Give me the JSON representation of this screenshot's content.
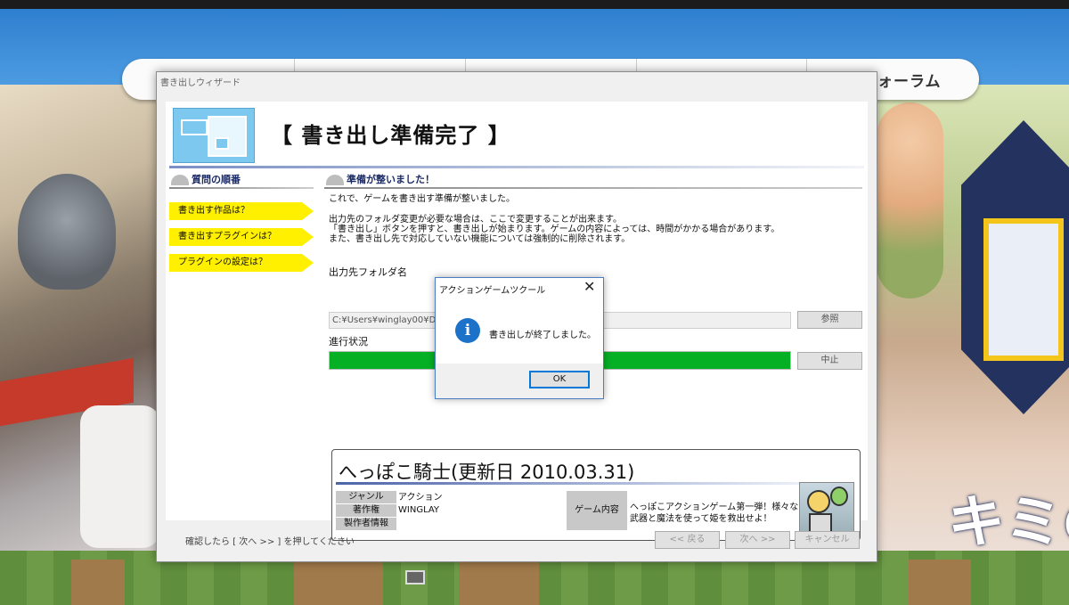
{
  "site": {
    "nav_partial_label": "ォーラム",
    "background_kana": "キミの"
  },
  "wizard": {
    "window_title": "書き出しウィザード",
    "header_title": "【 書き出し準備完了 】",
    "steps_heading": "質問の順番",
    "steps": [
      "書き出す作品は？",
      "書き出すプラグインは？",
      "プラグインの設定は？"
    ],
    "status_heading": "準備が整いました！",
    "message_1": "これで、ゲームを書き出す準備が整いました。",
    "message_2": "出力先のフォルダ変更が必要な場合は、ここで変更することが出来ます。",
    "message_3": "「書き出し」ボタンを押すと、書き出しが始まります。ゲームの内容によっては、時間がかかる場合があります。",
    "message_4": "また、書き出し先で対応していない機能については強制的に削除されます。",
    "output_folder_label": "出力先フォルダ名",
    "output_folder_value": "C:¥Users¥winglay00¥Doc",
    "browse_button": "参照",
    "progress_label": "進行状況",
    "progress_fraction": 1.0,
    "abort_button": "中止",
    "game": {
      "title": "へっぽこ騎士(更新日 2010.03.31)",
      "genre_key": "ジャンル",
      "genre_value": "アクション",
      "copyright_key": "著作権",
      "copyright_value": "WINGLAY",
      "author_info_key": "製作者情報",
      "content_key": "ゲーム内容",
      "content_value_1": "へっぽこアクションゲーム第一弾！様々な",
      "content_value_2": "武器と魔法を使って姫を救出せよ！"
    },
    "footer_hint": "確認したら [ 次へ >> ] を押してください",
    "back_button": "<< 戻る",
    "next_button": "次へ >>",
    "cancel_button": "キャンセル"
  },
  "dialog": {
    "title": "アクションゲームツクール",
    "close_glyph": "✕",
    "icon_glyph": "i",
    "icon": "info-icon",
    "message": "書き出しが終了しました。",
    "ok_button": "OK"
  },
  "colors": {
    "progress": "#06b025",
    "step_highlight": "#fff000",
    "info_icon": "#1c72c9"
  }
}
